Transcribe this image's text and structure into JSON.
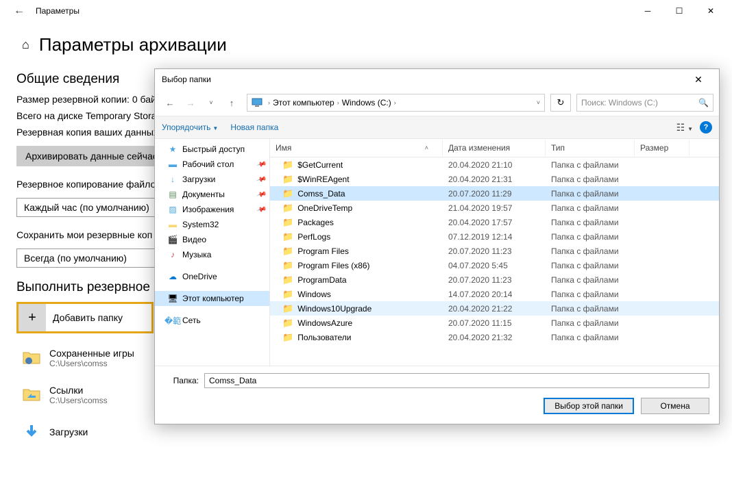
{
  "settings": {
    "window_title": "Параметры",
    "page_title": "Параметры архивации",
    "section_general": "Общие сведения",
    "backup_size": "Размер резервной копии: 0 бай",
    "total_disk": "Всего на диске Temporary Stora",
    "backup_data": "Резервная копия ваших данных",
    "backup_now_btn": "Архивировать данные сейчас",
    "backup_copy": "Резервное копирование файло",
    "freq_dropdown": "Каждый час (по умолчанию)",
    "keep_label": "Сохранить мои резервные коп",
    "keep_dropdown": "Всегда (по умолчанию)",
    "section_backup": "Выполнить резервное",
    "add_folder": "Добавить папку",
    "items": [
      {
        "name": "Сохраненные игры",
        "path": "C:\\Users\\comss"
      },
      {
        "name": "Ссылки",
        "path": "C:\\Users\\comss"
      },
      {
        "name": "Загрузки",
        "path": ""
      }
    ]
  },
  "dialog": {
    "title": "Выбор папки",
    "breadcrumb": {
      "pc": "Этот компьютер",
      "drive": "Windows (C:)"
    },
    "search_placeholder": "Поиск: Windows (C:)",
    "organize": "Упорядочить",
    "new_folder": "Новая папка",
    "columns": {
      "name": "Имя",
      "date": "Дата изменения",
      "type": "Тип",
      "size": "Размер"
    },
    "tree": {
      "quick": "Быстрый доступ",
      "desktop": "Рабочий стол",
      "downloads": "Загрузки",
      "documents": "Документы",
      "pictures": "Изображения",
      "system32": "System32",
      "video": "Видео",
      "music": "Музыка",
      "onedrive": "OneDrive",
      "thispc": "Этот компьютер",
      "network": "Сеть"
    },
    "folder_type": "Папка с файлами",
    "files": [
      {
        "name": "$GetCurrent",
        "date": "20.04.2020 21:10",
        "state": ""
      },
      {
        "name": "$WinREAgent",
        "date": "20.04.2020 21:31",
        "state": ""
      },
      {
        "name": "Comss_Data",
        "date": "20.07.2020 11:29",
        "state": "sel"
      },
      {
        "name": "OneDriveTemp",
        "date": "21.04.2020 19:57",
        "state": ""
      },
      {
        "name": "Packages",
        "date": "20.04.2020 17:57",
        "state": ""
      },
      {
        "name": "PerfLogs",
        "date": "07.12.2019 12:14",
        "state": ""
      },
      {
        "name": "Program Files",
        "date": "20.07.2020 11:23",
        "state": ""
      },
      {
        "name": "Program Files (x86)",
        "date": "04.07.2020 5:45",
        "state": ""
      },
      {
        "name": "ProgramData",
        "date": "20.07.2020 11:23",
        "state": ""
      },
      {
        "name": "Windows",
        "date": "14.07.2020 20:14",
        "state": ""
      },
      {
        "name": "Windows10Upgrade",
        "date": "20.04.2020 21:22",
        "state": "hov"
      },
      {
        "name": "WindowsAzure",
        "date": "20.07.2020 11:15",
        "state": ""
      },
      {
        "name": "Пользователи",
        "date": "20.04.2020 21:32",
        "state": ""
      }
    ],
    "folder_label": "Папка:",
    "folder_value": "Comss_Data",
    "select_btn": "Выбор этой папки",
    "cancel_btn": "Отмена"
  }
}
